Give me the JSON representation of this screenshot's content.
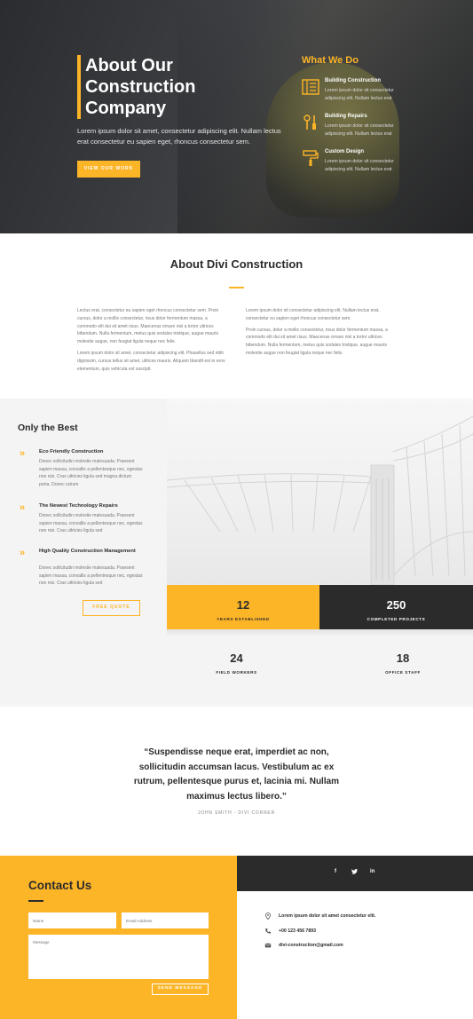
{
  "brand": {
    "accent": "#fdb528",
    "dark": "#2b2b2b"
  },
  "hero": {
    "title": "About Our Construction Company",
    "text": "Lorem ipsum dolor sit amet, consectetur adipiscing elit. Nullam lectus erat consectetur eu sapien eget, rhoncus consectetur sem.",
    "button": "VIEW OUR WORK",
    "what_we_do": {
      "title": "What We Do",
      "items": [
        {
          "icon": "blueprint-icon",
          "title": "Building Construction",
          "desc": "Lorem ipsum dolor sit consectetur adipiscing elit. Nullam lectus erat"
        },
        {
          "icon": "tools-icon",
          "title": "Building Repairs",
          "desc": "Lorem ipsum dolor sit consectetur adipiscing elit. Nullam lectus erat"
        },
        {
          "icon": "paint-roller-icon",
          "title": "Custom Design",
          "desc": "Lorem ipsum dolor sit consectetur adipiscing elit. Nullam lectus erat"
        }
      ]
    }
  },
  "about": {
    "title": "About Divi Construction",
    "left": [
      "Lectus erat, consectetur eu sapien eget rhoncus consectetur sem. Proin cursus, dolor a mollis consectetur, risus dolor fermentum massa, a commodo elit dui sit amet risus. Maecenas ornare nisl a tortor ultrices bibendum. Nulla fermentum, metus quis sodales tristique, augue mauris molestie augue, non feugiat ligula neque nec felis.",
      "Lorem ipsum dolor sit amet, consectetur adipiscing elit. Phasellus sed nibh dignissim, cursus tellus sit amet, ultrices mauris. Aliquam blandit est in eros elementum, quis vehicula est suscipit."
    ],
    "right": [
      "Lorem ipsum dolor sit consectetur adipiscing elit. Nullam lectus erat, consectetur eu sapien eget rhoncus consectetur sem.",
      "Proin cursus, dolor a mollis consectetur, risus dolor fermentum massa, a commodo elit dui sit amet risus. Maecenas ornare nisl a tortor ultrices bibendum. Nulla fermentum, metus quis sodales tristique, augue mauris molestie augue non feugiat ligula neque nec felis."
    ]
  },
  "best": {
    "title": "Only the Best",
    "features": [
      {
        "title": "Eco Friendly Construction",
        "desc": "Donec sollicitudin molestie malesuada. Praesent sapien massa, convallis a pellentesque nec, egestas non nisi. Cras ultricies ligula sed magna dictum porta. Donec rutrum"
      },
      {
        "title": "The Newest Technology Repairs",
        "desc": "Donec sollicitudin molestie malesuada. Praesent sapien massa, convallis a pellentesque nec, egestas non nisi. Cras ultricies ligula sed"
      },
      {
        "title": "High Quality Construction Management",
        "desc": "Donec sollicitudin molestie malesuada. Praesent sapien massa, convallis a pellentesque nec, egestas non nisi. Cras ultricies ligula sed"
      }
    ],
    "button": "FREE QUOTE"
  },
  "stats": [
    {
      "number": "12",
      "label": "YEARS ESTABLISHED"
    },
    {
      "number": "250",
      "label": "COMPLETED PROJECTS"
    },
    {
      "number": "24",
      "label": "FIELD WORKERS"
    },
    {
      "number": "18",
      "label": "OFFICE STAFF"
    }
  ],
  "testimonial": {
    "quote": "“Suspendisse neque erat, imperdiet ac non, sollicitudin accumsan lacus. Vestibulum ac ex rutrum, pellentesque purus et, lacinia mi. Nullam maximus lectus libero.”",
    "author": "JOHN SMITH - DIVI CORNER"
  },
  "contact": {
    "title": "Contact Us",
    "name_placeholder": "Name",
    "email_placeholder": "Email Address",
    "message_placeholder": "Message",
    "button": "SEND MESSAGE",
    "social": [
      "f",
      "t",
      "in"
    ],
    "info": [
      {
        "icon": "map-pin-icon",
        "text": "Lorem ipsum dolor sit amet consectetur elit."
      },
      {
        "icon": "phone-icon",
        "text": "+00 123 456 7893"
      },
      {
        "icon": "mail-icon",
        "text": "divi-construction@gmail.com"
      }
    ]
  }
}
